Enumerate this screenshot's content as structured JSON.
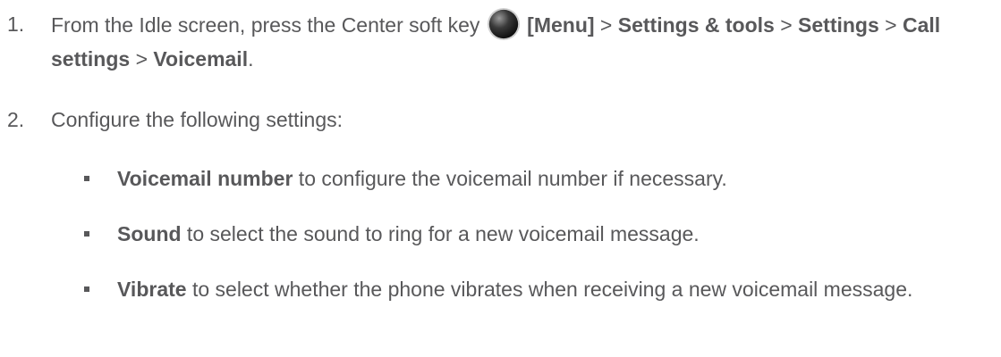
{
  "step1": {
    "number": "1.",
    "text_before": "From the Idle screen, press the Center soft key ",
    "icon": "center-soft-key-icon",
    "menu": "[Menu]",
    "sep1": " > ",
    "path1": "Settings & tools",
    "sep2": " > ",
    "path2": "Settings",
    "sep3": " > ",
    "path3": "Call settings",
    "sep4": " > ",
    "path4": "Voicemail",
    "end": "."
  },
  "step2": {
    "number": "2.",
    "text": "Configure the following settings:"
  },
  "bullets": [
    {
      "term": "Voicemail number",
      "desc": " to configure the voicemail number if necessary."
    },
    {
      "term": "Sound",
      "desc": " to select the sound to ring for a new voicemail message."
    },
    {
      "term": "Vibrate",
      "desc": " to select whether the phone vibrates when receiving a new voicemail message."
    }
  ]
}
